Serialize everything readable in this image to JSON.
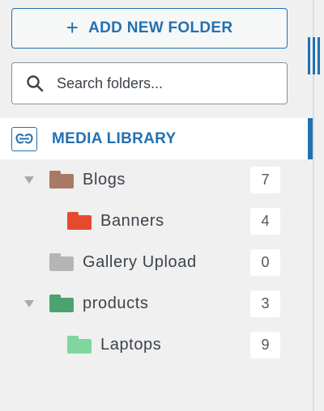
{
  "toolbar": {
    "add_label": "ADD NEW FOLDER"
  },
  "search": {
    "placeholder": "Search folders..."
  },
  "library": {
    "label": "MEDIA LIBRARY"
  },
  "colors": {
    "accent": "#2271b1",
    "folder_blogs": "#a87965",
    "folder_banners": "#e64a2e",
    "folder_gallery": "#b5b5b5",
    "folder_products": "#4ca36f",
    "folder_laptops": "#7fd6a0"
  },
  "folders": [
    {
      "name": "Blogs",
      "count": "7",
      "expanded": true
    },
    {
      "name": "Banners",
      "count": "4"
    },
    {
      "name": "Gallery Upload",
      "count": "0"
    },
    {
      "name": "products",
      "count": "3",
      "expanded": true
    },
    {
      "name": "Laptops",
      "count": "9"
    }
  ]
}
